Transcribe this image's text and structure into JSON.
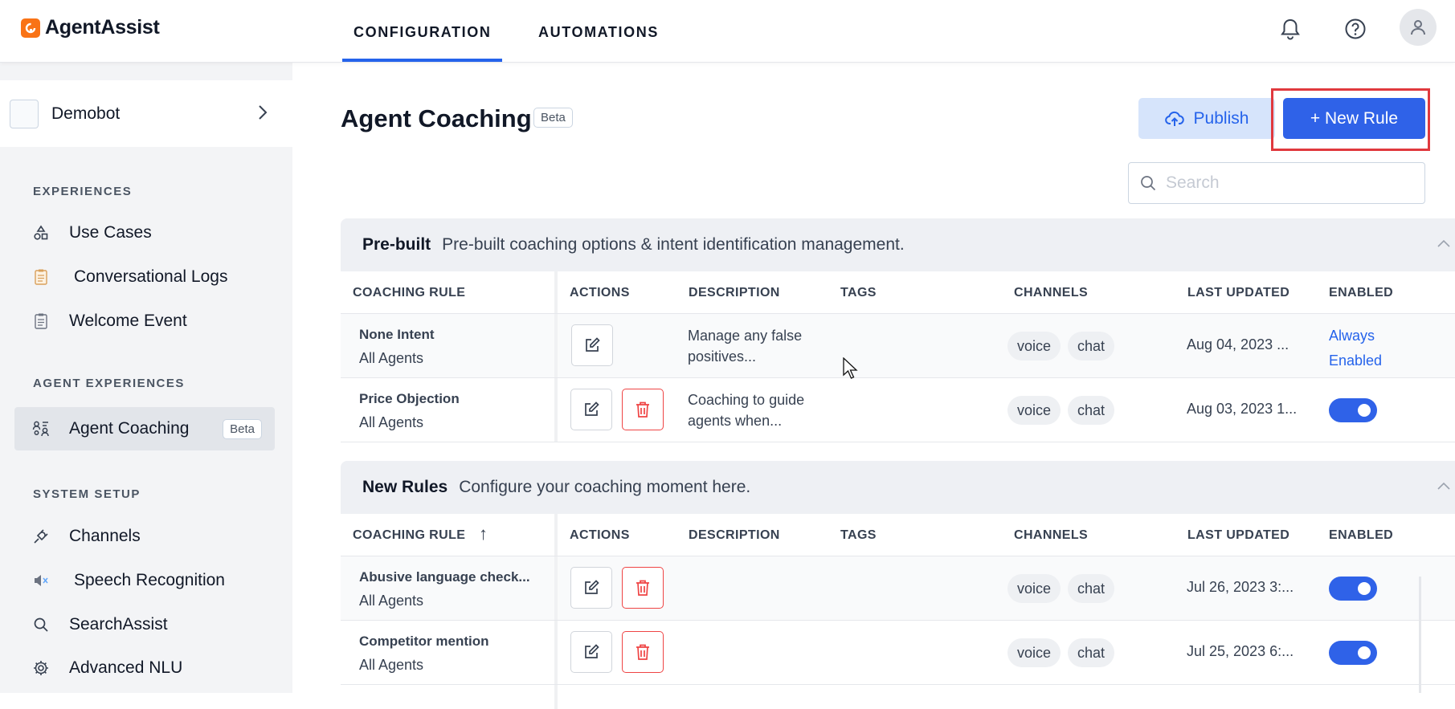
{
  "app": {
    "name": "AgentAssist"
  },
  "nav_tabs": [
    {
      "label": "CONFIGURATION",
      "active": true
    },
    {
      "label": "AUTOMATIONS",
      "active": false
    }
  ],
  "header_icons": [
    "bell-icon",
    "help-icon",
    "user-avatar-icon"
  ],
  "sidebar": {
    "bot": {
      "name": "Demobot"
    },
    "sections": [
      {
        "title": "EXPERIENCES",
        "items": [
          {
            "label": "Use Cases",
            "icon": "shapes-icon"
          },
          {
            "label": "Conversational Logs",
            "icon": "clipboard-icon"
          },
          {
            "label": "Welcome Event",
            "icon": "checklist-icon"
          }
        ]
      },
      {
        "title": "AGENT EXPERIENCES",
        "items": [
          {
            "label": "Agent Coaching",
            "icon": "coaching-icon",
            "badge": "Beta",
            "active": true
          }
        ]
      },
      {
        "title": "SYSTEM SETUP",
        "items": [
          {
            "label": "Channels",
            "icon": "plug-icon"
          },
          {
            "label": "Speech Recognition",
            "icon": "speaker-icon"
          },
          {
            "label": "SearchAssist",
            "icon": "search-icon"
          },
          {
            "label": "Advanced NLU",
            "icon": "gear-icon"
          }
        ]
      }
    ]
  },
  "page": {
    "title": "Agent Coaching",
    "badge": "Beta",
    "publish_label": "Publish",
    "new_rule_label": "+ New Rule",
    "search_placeholder": "Search"
  },
  "columns": {
    "rule": "COACHING RULE",
    "actions": "ACTIONS",
    "description": "DESCRIPTION",
    "tags": "TAGS",
    "channels": "CHANNELS",
    "last_updated": "LAST UPDATED",
    "enabled": "ENABLED"
  },
  "groups": {
    "prebuilt": {
      "name": "Pre-built",
      "description": "Pre-built coaching options & intent identification management.",
      "rows": [
        {
          "name": "None Intent",
          "agents": "All Agents",
          "description": "Manage any false positives...",
          "channels": [
            "voice",
            "chat"
          ],
          "updated": "Aug 04, 2023 ...",
          "enabled_text": "Always Enabled"
        },
        {
          "name": "Price Objection",
          "agents": "All Agents",
          "description": "Coaching to guide agents when...",
          "channels": [
            "voice",
            "chat"
          ],
          "updated": "Aug 03, 2023 1...",
          "enabled": true
        }
      ]
    },
    "newrules": {
      "name": "New Rules",
      "description": "Configure your coaching moment here.",
      "sort_indicator": "↑",
      "rows": [
        {
          "name": "Abusive language check...",
          "agents": "All Agents",
          "channels": [
            "voice",
            "chat"
          ],
          "updated": "Jul 26, 2023 3:...",
          "enabled": true
        },
        {
          "name": "Competitor mention",
          "agents": "All Agents",
          "channels": [
            "voice",
            "chat"
          ],
          "updated": "Jul 25, 2023 6:...",
          "enabled": true
        }
      ]
    }
  },
  "colors": {
    "primary": "#2f62e8",
    "highlight": "#e0393e",
    "logo": "#f97316",
    "delete": "#ef4444"
  }
}
